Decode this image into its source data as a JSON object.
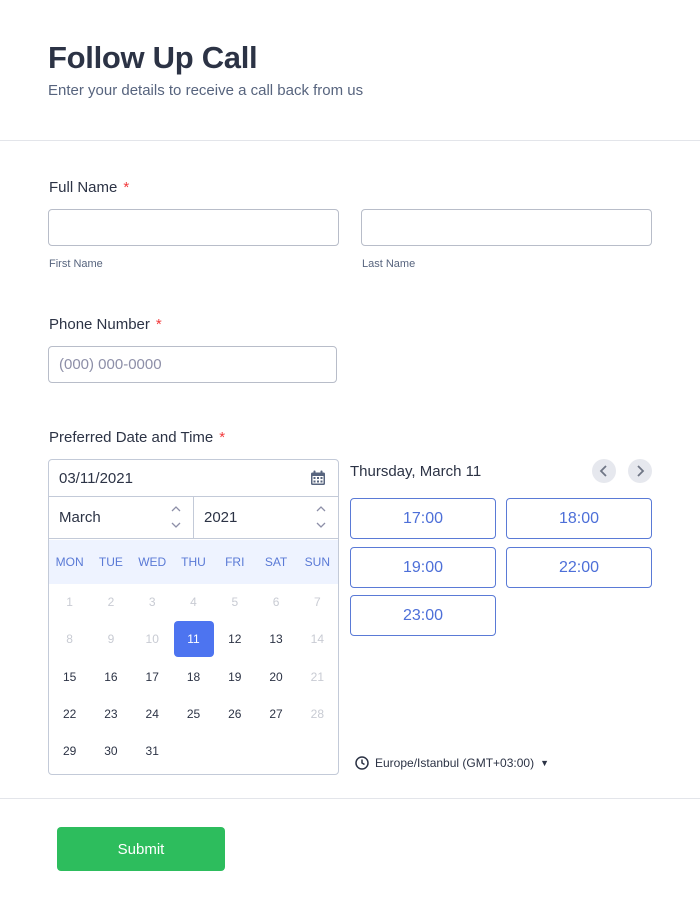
{
  "header": {
    "title": "Follow Up Call",
    "subtitle": "Enter your details to receive a call back from us"
  },
  "full_name": {
    "label": "Full Name",
    "required_mark": "*",
    "first_value": "",
    "last_value": "",
    "first_sublabel": "First Name",
    "last_sublabel": "Last Name"
  },
  "phone": {
    "label": "Phone Number",
    "required_mark": "*",
    "placeholder": "(000) 000-0000"
  },
  "date_time": {
    "label": "Preferred Date and Time",
    "required_mark": "*",
    "date_value": "03/11/2021",
    "month": "March",
    "year": "2021",
    "weekdays": [
      "MON",
      "TUE",
      "WED",
      "THU",
      "FRI",
      "SAT",
      "SUN"
    ],
    "weeks": [
      [
        {
          "d": "1",
          "s": "disabled"
        },
        {
          "d": "2",
          "s": "disabled"
        },
        {
          "d": "3",
          "s": "disabled"
        },
        {
          "d": "4",
          "s": "disabled"
        },
        {
          "d": "5",
          "s": "disabled"
        },
        {
          "d": "6",
          "s": "disabled"
        },
        {
          "d": "7",
          "s": "disabled"
        }
      ],
      [
        {
          "d": "8",
          "s": "disabled"
        },
        {
          "d": "9",
          "s": "disabled"
        },
        {
          "d": "10",
          "s": "disabled"
        },
        {
          "d": "11",
          "s": "selected"
        },
        {
          "d": "12",
          "s": "active"
        },
        {
          "d": "13",
          "s": "active"
        },
        {
          "d": "14",
          "s": "disabled"
        }
      ],
      [
        {
          "d": "15",
          "s": "active"
        },
        {
          "d": "16",
          "s": "active"
        },
        {
          "d": "17",
          "s": "active"
        },
        {
          "d": "18",
          "s": "active"
        },
        {
          "d": "19",
          "s": "active"
        },
        {
          "d": "20",
          "s": "active"
        },
        {
          "d": "21",
          "s": "disabled"
        }
      ],
      [
        {
          "d": "22",
          "s": "active"
        },
        {
          "d": "23",
          "s": "active"
        },
        {
          "d": "24",
          "s": "active"
        },
        {
          "d": "25",
          "s": "active"
        },
        {
          "d": "26",
          "s": "active"
        },
        {
          "d": "27",
          "s": "active"
        },
        {
          "d": "28",
          "s": "disabled"
        }
      ],
      [
        {
          "d": "29",
          "s": "active"
        },
        {
          "d": "30",
          "s": "active"
        },
        {
          "d": "31",
          "s": "active"
        }
      ]
    ],
    "selected_day_heading": "Thursday, March 11",
    "slots": [
      "17:00",
      "18:00",
      "19:00",
      "22:00",
      "23:00"
    ],
    "timezone": "Europe/Istanbul (GMT+03:00)"
  },
  "icons": {
    "calendar": "calendar-icon",
    "prev": "chevron-left-icon",
    "next": "chevron-right-icon",
    "clock": "clock-icon",
    "caret": "caret-down-icon"
  },
  "colors": {
    "accent": "#4d74f0",
    "submit": "#2dbd5d",
    "required": "#f23a3c"
  },
  "submit_label": "Submit"
}
